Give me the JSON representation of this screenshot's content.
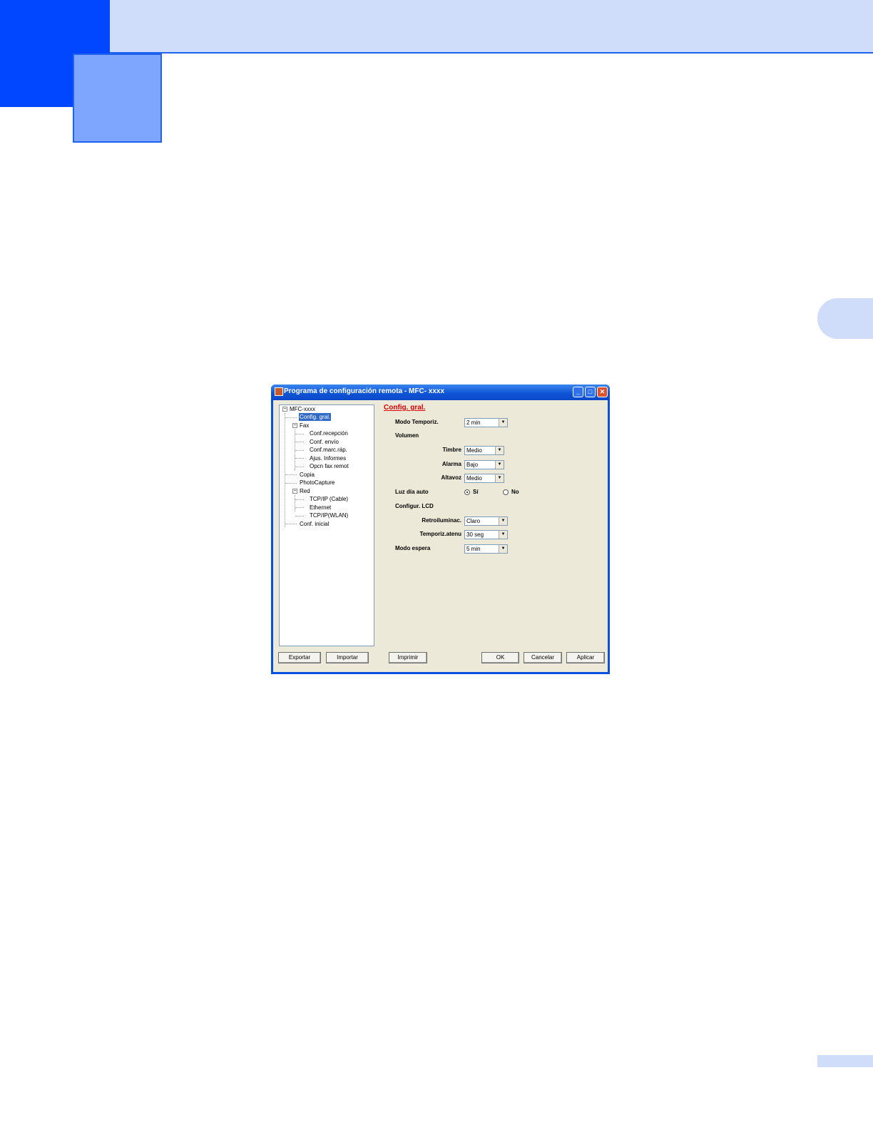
{
  "window": {
    "title": "Programa de configuración remota - MFC- xxxx",
    "controls": {
      "minimize": "_",
      "maximize": "□",
      "close": "✕"
    }
  },
  "tree": {
    "root": "MFC-xxxx",
    "selected": "Config. gral.",
    "fax": "Fax",
    "fax_children": [
      "Conf.recepción",
      "Conf. envío",
      "Conf.marc.ráp.",
      "Ajus. Informes",
      "Opcn fax remot"
    ],
    "copia": "Copia",
    "photocapture": "PhotoCapture",
    "red": "Red",
    "red_children": [
      "TCP/IP (Cable)",
      "Ethernet",
      "TCP/IP(WLAN)"
    ],
    "conf_inicial": "Conf. inicial"
  },
  "settings": {
    "section_title": "Config. gral.",
    "modo_temporiz": {
      "label": "Modo Temporiz.",
      "value": "2 min"
    },
    "volumen": {
      "label": "Volumen"
    },
    "timbre": {
      "label": "Timbre",
      "value": "Medio"
    },
    "alarma": {
      "label": "Alarma",
      "value": "Bajo"
    },
    "altavoz": {
      "label": "Altavoz",
      "value": "Medio"
    },
    "luz_dia": {
      "label": "Luz día auto",
      "option_si": "Sí",
      "option_no": "No",
      "selected": "Sí"
    },
    "config_lcd": {
      "label": "Configur. LCD"
    },
    "retroilum": {
      "label": "Retroiluminac.",
      "value": "Claro"
    },
    "temporiz_atenu": {
      "label": "Temporiz.atenu",
      "value": "30 seg"
    },
    "modo_espera": {
      "label": "Modo espera",
      "value": "5 min"
    }
  },
  "buttons": {
    "exportar": "Exportar",
    "importar": "Importar",
    "imprimir": "Imprimir",
    "ok": "OK",
    "cancelar": "Cancelar",
    "aplicar": "Aplicar"
  },
  "colors": {
    "header_dark": "#0047ff",
    "header_light": "#7fa6ff",
    "header_band": "#cfddfb",
    "section_title": "#e00000"
  }
}
